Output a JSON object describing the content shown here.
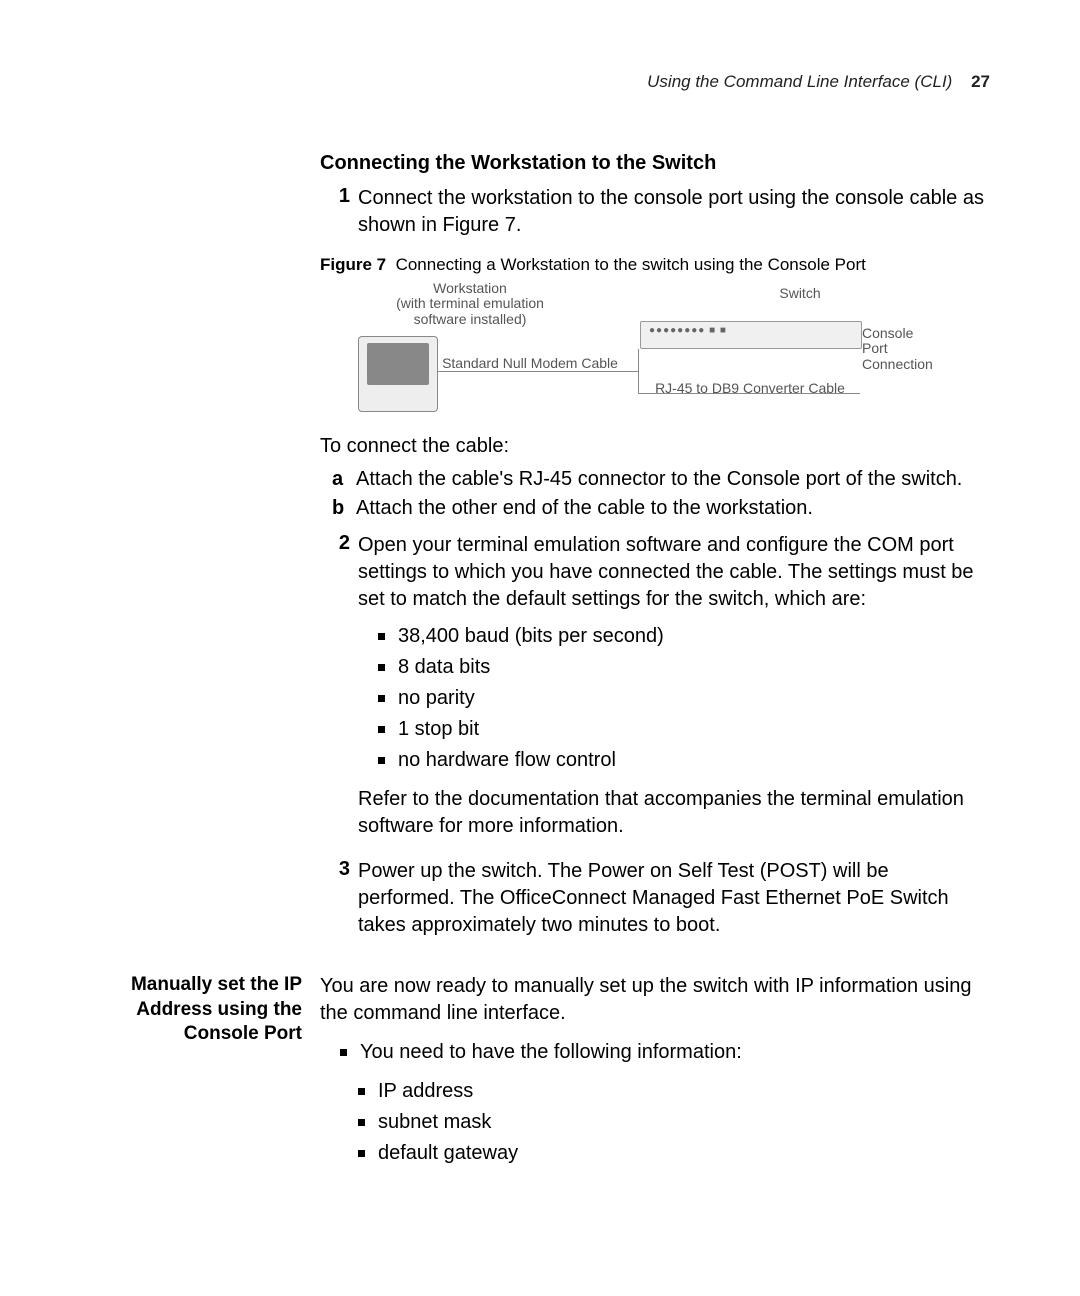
{
  "header": {
    "title": "Using the Command Line Interface (CLI)",
    "page_number": "27"
  },
  "section1": {
    "heading": "Connecting the Workstation to the Switch",
    "step1": {
      "num": "1",
      "text": "Connect the workstation to the console port using the console cable as shown in Figure 7."
    },
    "figure": {
      "label": "Figure 7",
      "caption": "Connecting a Workstation to the switch using the Console Port",
      "workstation_label": "Workstation\n(with terminal emulation\nsoftware installed)",
      "switch_label": "Switch",
      "console_port_label": "Console Port Connection",
      "standard_cable": "Standard Null Modem Cable",
      "rj45_cable": "RJ-45 to DB9  Converter Cable"
    },
    "connect_intro": "To connect the cable:",
    "step_a": {
      "lbl": "a",
      "text": "Attach the cable's RJ-45 connector to the Console port of the switch."
    },
    "step_b": {
      "lbl": "b",
      "text": "Attach the other end of the cable to the workstation."
    },
    "step2": {
      "num": "2",
      "text": "Open your terminal emulation software and configure the COM port settings to which you have connected the cable. The settings must be set to match the default settings for the switch, which are:",
      "bullets": [
        "38,400 baud (bits per second)",
        "8 data bits",
        "no parity",
        "1 stop bit",
        "no hardware flow control"
      ],
      "after": "Refer to the documentation that accompanies the terminal emulation software for more information."
    },
    "step3": {
      "num": "3",
      "text": "Power up the switch. The Power on Self Test (POST) will be performed. The OfficeConnect Managed Fast Ethernet PoE Switch takes approximately two minutes to boot."
    }
  },
  "section2": {
    "side_heading": "Manually set the IP Address using the Console Port",
    "intro": "You are now ready to manually set up the switch with IP information using the command line interface.",
    "need_info": "You need to have the following information:",
    "info_items": [
      "IP address",
      "subnet mask",
      "default gateway"
    ]
  }
}
